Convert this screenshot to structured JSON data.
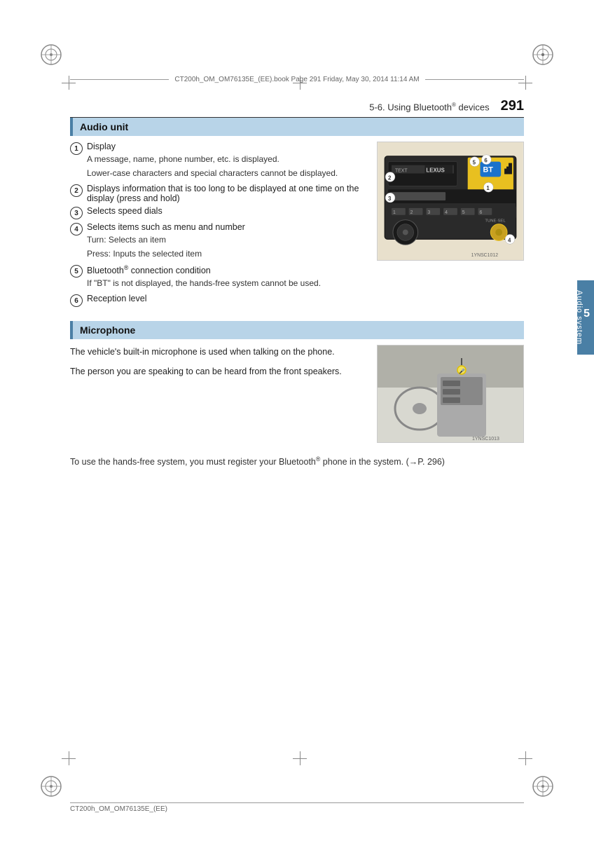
{
  "page": {
    "number": "291",
    "header_title": "5-6. Using Bluetooth",
    "header_title_sup": "®",
    "header_title_suffix": " devices",
    "file_info": "CT200h_OM_OM76135E_(EE).book   Page 291   Friday, May 30, 2014   11:14 AM",
    "footer_text": "CT200h_OM_OM76135E_(EE)"
  },
  "audio_unit_section": {
    "title": "Audio unit",
    "items": [
      {
        "num": "1",
        "title": "Display",
        "sub1": "A message, name, phone number, etc. is displayed.",
        "sub2": "Lower-case characters and special characters cannot be displayed."
      },
      {
        "num": "2",
        "title": "Displays information that is too long to be displayed at one time on the display (press and hold)"
      },
      {
        "num": "3",
        "title": "Selects speed dials"
      },
      {
        "num": "4",
        "title": "Selects items such as menu and number",
        "sub1": "Turn: Selects an item",
        "sub2": "Press: Inputs the selected item"
      },
      {
        "num": "5",
        "title": "Bluetooth",
        "title_sup": "®",
        "title_suffix": " connection condition",
        "sub1": "If \"BT\" is not displayed, the hands-free system cannot be used."
      },
      {
        "num": "6",
        "title": "Reception level"
      }
    ],
    "image_label": "1YNSC1012"
  },
  "microphone_section": {
    "title": "Microphone",
    "text1": "The vehicle's built-in microphone is used when talking on the phone.",
    "text2": "The person you are speaking to can be heard from the front speakers.",
    "image_label": "1YNSC1013"
  },
  "bottom_note": {
    "text": "To use the hands-free system, you must register your Bluetooth",
    "sup": "®",
    "text2": " phone in the system. (→P. 296)"
  },
  "side_tab": {
    "number": "5",
    "label": "Audio system"
  }
}
